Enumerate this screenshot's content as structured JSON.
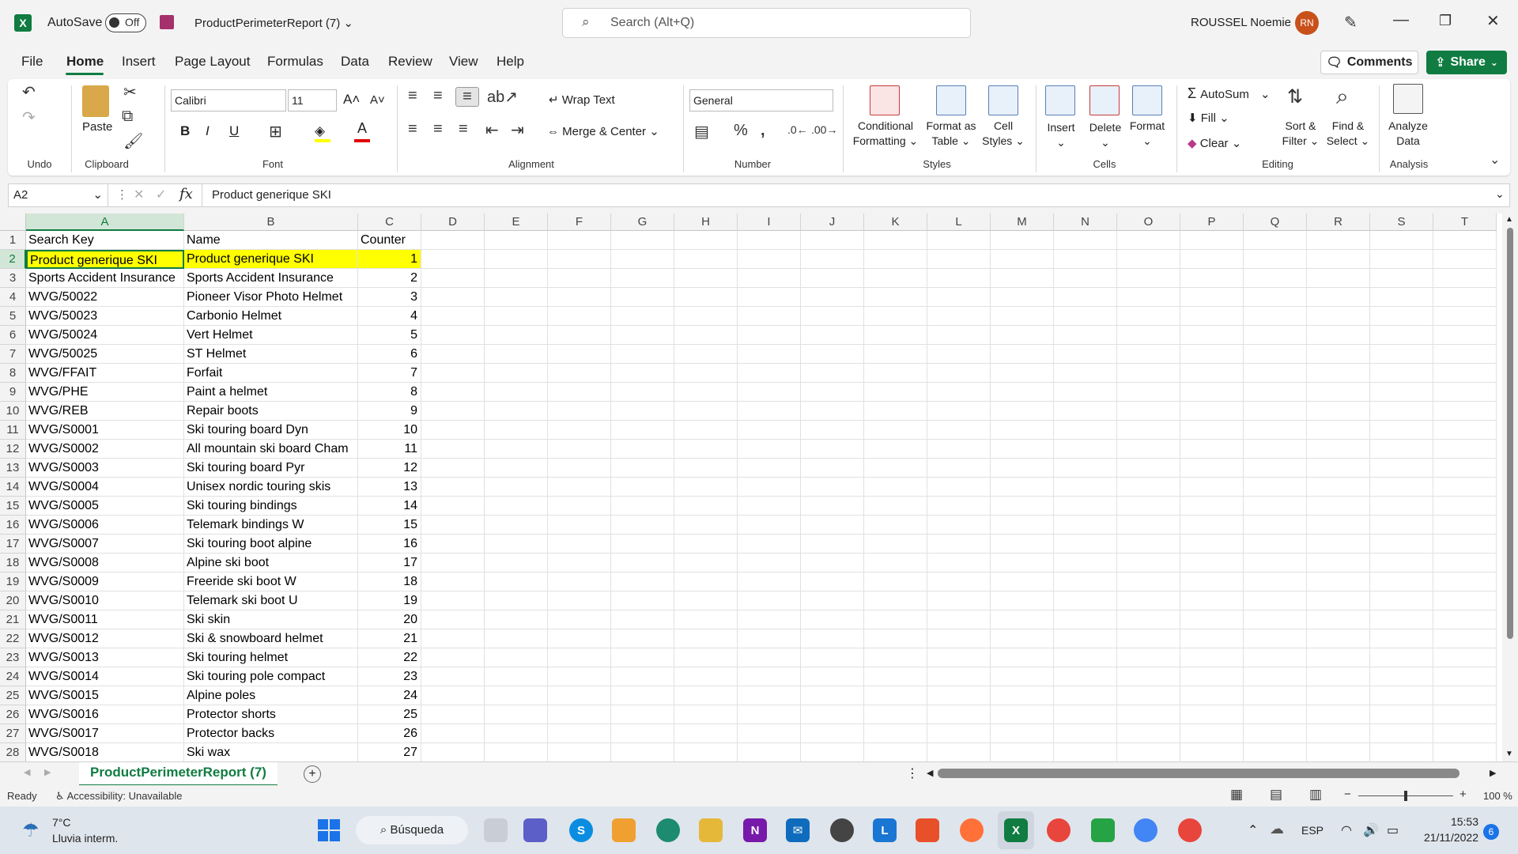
{
  "titlebar": {
    "app_letter": "X",
    "autosave_label": "AutoSave",
    "autosave_state": "Off",
    "file_name": "ProductPerimeterReport (7)",
    "search_placeholder": "Search (Alt+Q)",
    "user_name": "ROUSSEL Noemie",
    "user_initials": "RN"
  },
  "menu": {
    "items": [
      "File",
      "Home",
      "Insert",
      "Page Layout",
      "Formulas",
      "Data",
      "Review",
      "View",
      "Help"
    ],
    "active": "Home",
    "comments_label": "Comments",
    "share_label": "Share"
  },
  "ribbon": {
    "groups": {
      "undo": "Undo",
      "clipboard": "Clipboard",
      "font": "Font",
      "alignment": "Alignment",
      "number": "Number",
      "styles": "Styles",
      "cells": "Cells",
      "editing": "Editing",
      "analysis": "Analysis"
    },
    "paste": "Paste",
    "font_name": "Calibri",
    "font_size": "11",
    "wrap_text": "Wrap Text",
    "merge_center": "Merge & Center",
    "number_format": "General",
    "conditional_formatting": [
      "Conditional",
      "Formatting"
    ],
    "format_as_table": [
      "Format as",
      "Table"
    ],
    "cell_styles": [
      "Cell",
      "Styles"
    ],
    "insert": "Insert",
    "delete": "Delete",
    "format": "Format",
    "autosum": "AutoSum",
    "fill": "Fill",
    "clear": "Clear",
    "sort_filter": [
      "Sort &",
      "Filter"
    ],
    "find_select": [
      "Find &",
      "Select"
    ],
    "analyze_data": [
      "Analyze",
      "Data"
    ],
    "bold": "B",
    "italic": "I",
    "underline": "U"
  },
  "formula_bar": {
    "name_box": "A2",
    "fx": "fx",
    "content": "Product generique SKI"
  },
  "columns": [
    "A",
    "B",
    "C",
    "D",
    "E",
    "F",
    "G",
    "H",
    "I",
    "J",
    "K",
    "L",
    "M",
    "N",
    "O",
    "P",
    "Q",
    "R",
    "S",
    "T"
  ],
  "rows": [
    [
      "Search Key",
      "Name",
      "Counter"
    ],
    [
      "Product generique SKI",
      "Product generique SKI",
      "1"
    ],
    [
      "Sports Accident Insurance",
      "Sports Accident Insurance",
      "2"
    ],
    [
      "WVG/50022",
      "Pioneer Visor Photo Helmet",
      "3"
    ],
    [
      "WVG/50023",
      "Carbonio Helmet",
      "4"
    ],
    [
      "WVG/50024",
      "Vert Helmet",
      "5"
    ],
    [
      "WVG/50025",
      "ST Helmet",
      "6"
    ],
    [
      "WVG/FFAIT",
      "Forfait",
      "7"
    ],
    [
      "WVG/PHE",
      "Paint a helmet",
      "8"
    ],
    [
      "WVG/REB",
      "Repair boots",
      "9"
    ],
    [
      "WVG/S0001",
      "Ski touring board Dyn",
      "10"
    ],
    [
      "WVG/S0002",
      "All mountain ski board Cham",
      "11"
    ],
    [
      "WVG/S0003",
      "Ski touring board Pyr",
      "12"
    ],
    [
      "WVG/S0004",
      "Unisex nordic touring skis",
      "13"
    ],
    [
      "WVG/S0005",
      "Ski touring bindings",
      "14"
    ],
    [
      "WVG/S0006",
      "Telemark bindings W",
      "15"
    ],
    [
      "WVG/S0007",
      "Ski touring boot alpine",
      "16"
    ],
    [
      "WVG/S0008",
      "Alpine ski boot",
      "17"
    ],
    [
      "WVG/S0009",
      "Freeride ski boot W",
      "18"
    ],
    [
      "WVG/S0010",
      "Telemark ski boot U",
      "19"
    ],
    [
      "WVG/S0011",
      "Ski skin",
      "20"
    ],
    [
      "WVG/S0012",
      "Ski & snowboard helmet",
      "21"
    ],
    [
      "WVG/S0013",
      "Ski touring helmet",
      "22"
    ],
    [
      "WVG/S0014",
      "Ski touring pole compact",
      "23"
    ],
    [
      "WVG/S0015",
      "Alpine poles",
      "24"
    ],
    [
      "WVG/S0016",
      "Protector shorts",
      "25"
    ],
    [
      "WVG/S0017",
      "Protector backs",
      "26"
    ],
    [
      "WVG/S0018",
      "Ski wax",
      "27"
    ]
  ],
  "sheet_tab": "ProductPerimeterReport (7)",
  "status": {
    "ready": "Ready",
    "accessibility": "Accessibility: Unavailable",
    "zoom": "100 %"
  },
  "taskbar": {
    "weather_temp": "7°C",
    "weather_desc": "Lluvia interm.",
    "search": "Búsqueda",
    "lang": "ESP",
    "time": "15:53",
    "date": "21/11/2022",
    "notif_count": "6"
  },
  "colors": {
    "excel_green": "#107c41",
    "highlight_yellow": "#ffff00",
    "avatar": "#c8511b"
  }
}
